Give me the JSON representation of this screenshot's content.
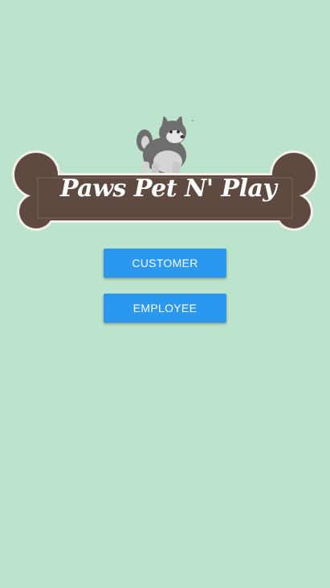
{
  "logo": {
    "text": "Paws Pet N' Play",
    "icon": "husky-dog-icon",
    "colors": {
      "bone": "#5e4a40",
      "bone_outline": "#f2f0e8",
      "dog_gray": "#6e6e6e",
      "dog_light": "#d4d4d4"
    }
  },
  "buttons": {
    "customer_label": "CUSTOMER",
    "employee_label": "EMPLOYEE"
  },
  "colors": {
    "background": "#bce3cb",
    "button": "#2b98f0"
  }
}
